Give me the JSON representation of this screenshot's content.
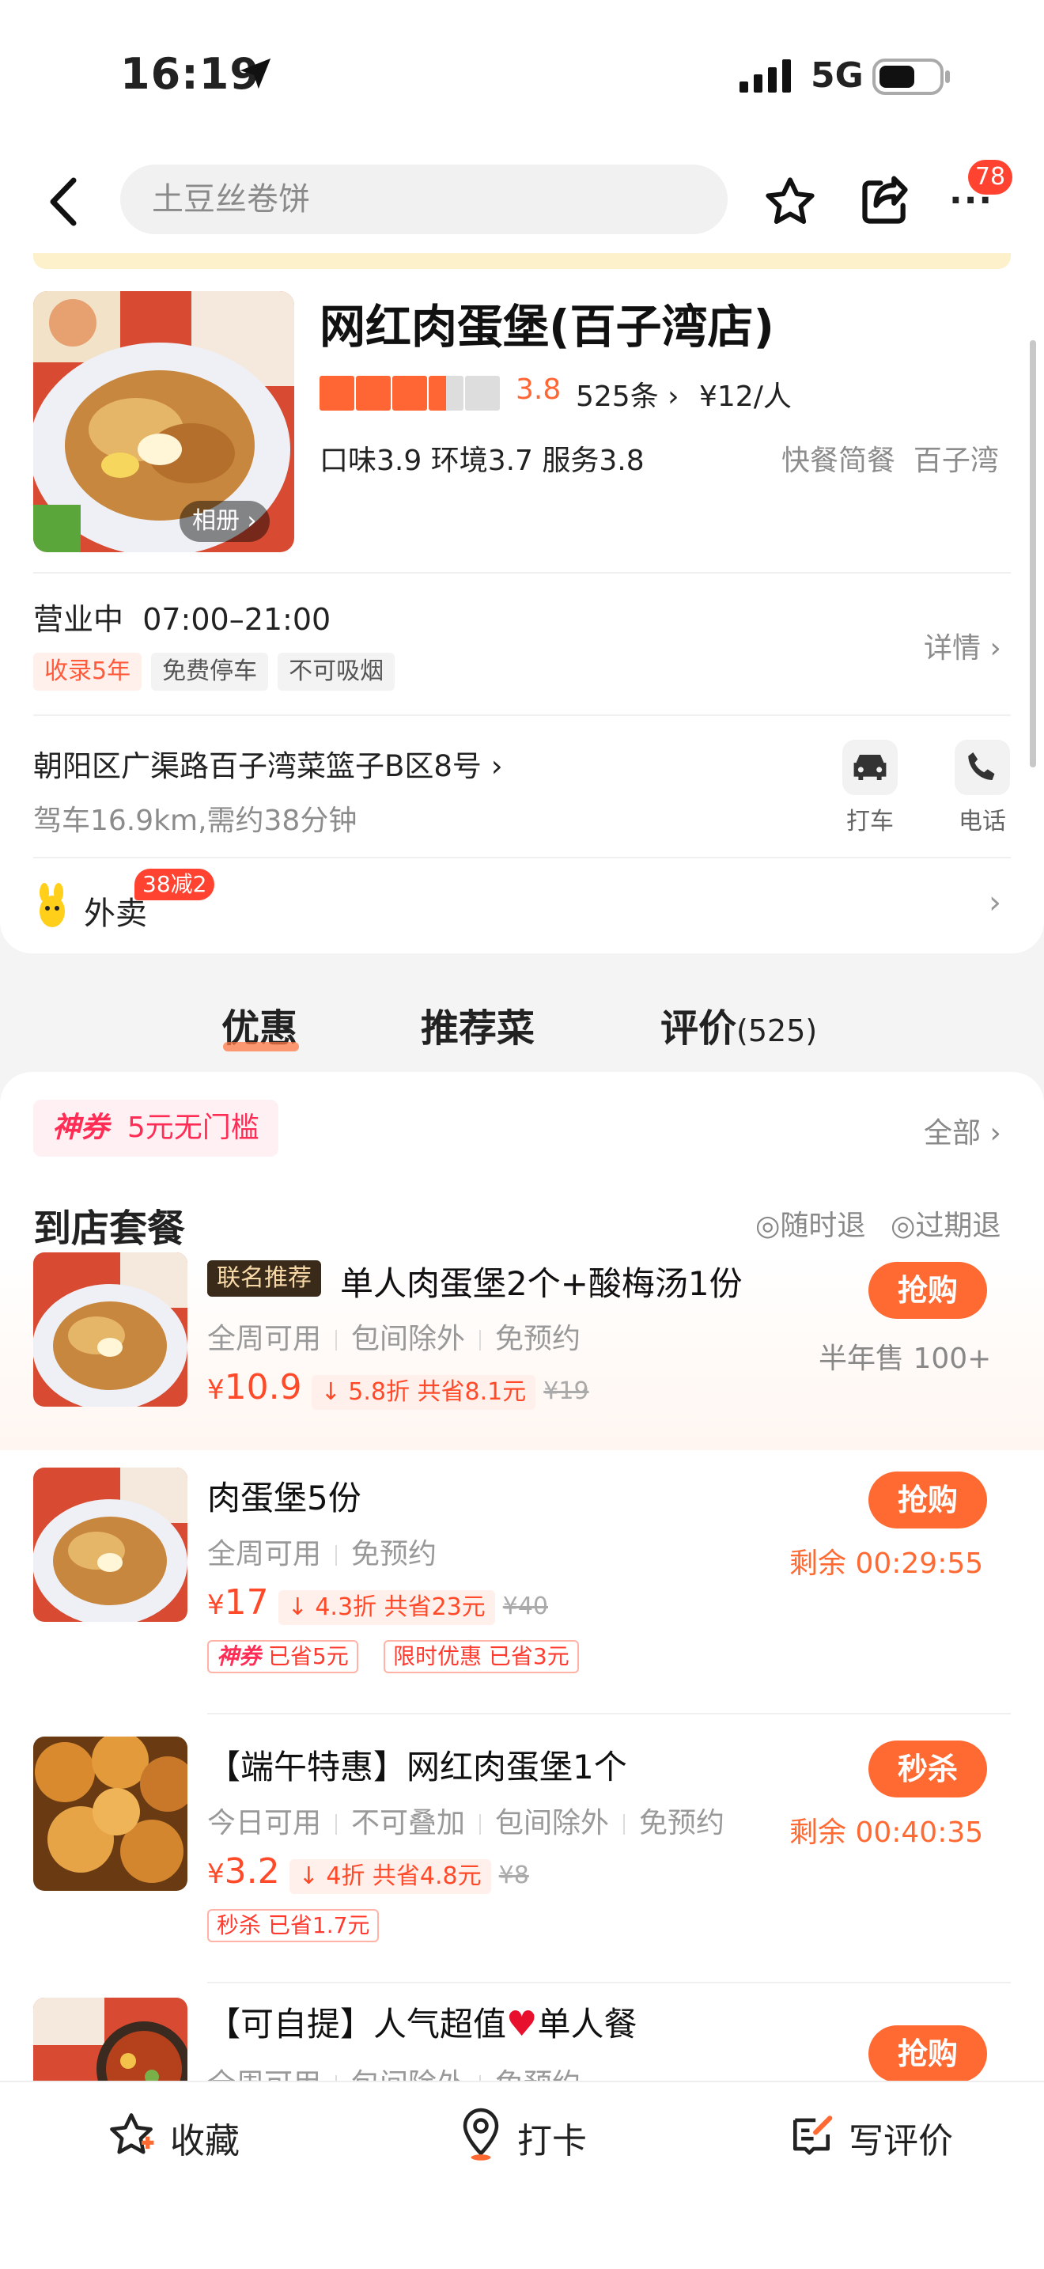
{
  "status": {
    "time": "16:19",
    "network": "5G"
  },
  "nav": {
    "search_placeholder": "土豆丝卷饼",
    "badge": "78"
  },
  "shop": {
    "name": "网红肉蛋堡(百子湾店)",
    "album": "相册",
    "rating": "3.8",
    "reviews": "525条",
    "per_person": "¥12/人",
    "scores": "口味3.9  环境3.7  服务3.8",
    "category": "快餐简餐  百子湾",
    "status": "营业中",
    "hours": "07:00–21:00",
    "tags": [
      "收录5年",
      "免费停车",
      "不可吸烟"
    ],
    "details": "详情",
    "address": "朝阳区广渠路百子湾菜篮子B区8号",
    "distance": "驾车16.9km,需约38分钟",
    "taxi": "打车",
    "phone": "电话",
    "delivery": "外卖",
    "delivery_badge": "38减2"
  },
  "tabs": [
    {
      "label": "优惠"
    },
    {
      "label": "推荐菜"
    },
    {
      "label": "评价",
      "count": "(525)"
    }
  ],
  "coupon": {
    "label": "神券",
    "text": "5元无门槛",
    "all": "全部"
  },
  "section": {
    "title": "到店套餐",
    "refund1": "随时退",
    "refund2": "过期退"
  },
  "deals": [
    {
      "badge": "联名推荐",
      "title": "单人肉蛋堡2个+酸梅汤1份",
      "sub": [
        "全周可用",
        "包间除外",
        "免预约"
      ],
      "price_sym": "¥",
      "price": "10.9",
      "discount": "5.8折 共省8.1元",
      "orig": "¥19",
      "buy": "抢购",
      "note": "半年售 100+"
    },
    {
      "title": "肉蛋堡5份",
      "sub": [
        "全周可用",
        "免预约"
      ],
      "price_sym": "¥",
      "price": "17",
      "discount": "4.3折 共省23元",
      "orig": "¥40",
      "buy": "抢购",
      "note": "剩余 00:29:55",
      "tags": [
        {
          "a": "神券",
          "b": "已省5元"
        },
        {
          "a": "限时优惠",
          "b": "已省3元"
        }
      ]
    },
    {
      "title": "【端午特惠】网红肉蛋堡1个",
      "sub": [
        "今日可用",
        "不可叠加",
        "包间除外",
        "免预约"
      ],
      "price_sym": "¥",
      "price": "3.2",
      "discount": "4折 共省4.8元",
      "orig": "¥8",
      "buy": "秒杀",
      "note": "剩余 00:40:35",
      "tags": [
        {
          "a": "秒杀",
          "b": "已省1.7元"
        }
      ]
    },
    {
      "title": "【可自提】人气超值",
      "title2": "单人餐",
      "sub": [
        "全周可用",
        "包间除外",
        "免预约"
      ],
      "buy": "抢购"
    }
  ],
  "bottom": {
    "fav": "收藏",
    "checkin": "打卡",
    "review": "写评价"
  },
  "colors": {
    "accent": "#ff6a33",
    "price": "#ff4a2a",
    "star": "#ff6633"
  }
}
